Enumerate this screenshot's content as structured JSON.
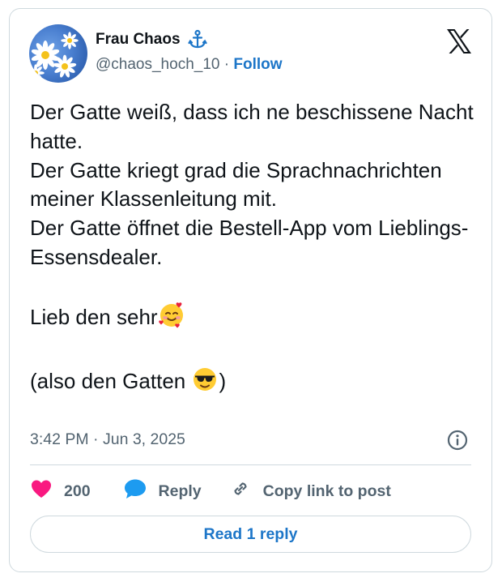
{
  "author": {
    "display_name": "Frau Chaos",
    "name_badge_icon": "anchor-icon",
    "handle": "@chaos_hoch_10",
    "separator": "·",
    "follow_label": "Follow",
    "avatar": "daisy-flowers-photo"
  },
  "platform_logo": "x-logo-icon",
  "tweet": {
    "lines": [
      "Der Gatte weiß, dass ich ne beschissene Nacht hatte.",
      "Der Gatte kriegt grad die Sprachnachrichten meiner Klassenleitung mit.",
      "Der Gatte öffnet die Bestell-App vom Lieblings-Essensdealer."
    ],
    "love_line": "Lieb den sehr",
    "love_emoji": "smiling-face-with-hearts",
    "closing_open": "(also den Gatten ",
    "closing_emoji": "smiling-face-with-sunglasses",
    "closing_close": ")"
  },
  "meta": {
    "time": "3:42 PM",
    "separator": "·",
    "date": "Jun 3, 2025",
    "info_icon": "info-icon"
  },
  "actions": {
    "like_count": "200",
    "like_icon": "heart-icon",
    "reply_label": "Reply",
    "reply_icon": "speech-bubble-icon",
    "copy_label": "Copy link to post",
    "copy_icon": "link-icon"
  },
  "read_reply_label": "Read 1 reply",
  "colors": {
    "link_blue": "#1d76c8",
    "heart_pink": "#f91880",
    "reply_blue": "#1d9bf0",
    "muted_text": "#536471",
    "border": "#cfd9de"
  }
}
